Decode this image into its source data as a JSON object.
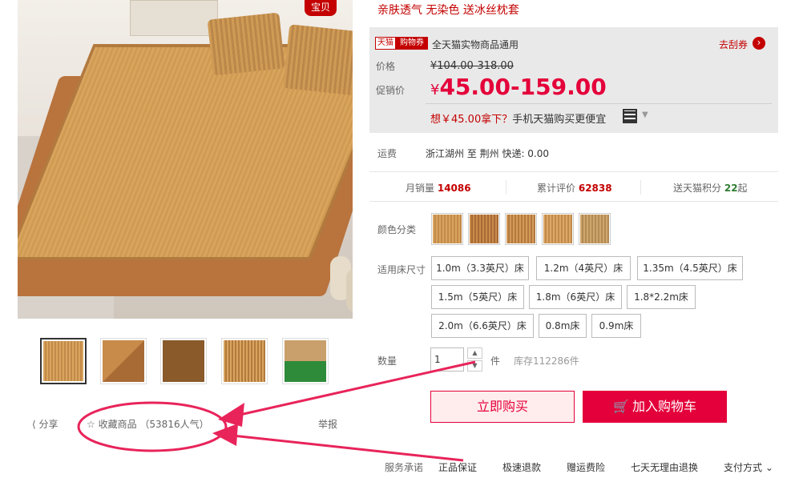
{
  "badge": "宝贝",
  "promo_line": "亲肤透气 无染色 送冰丝枕套",
  "coupon": {
    "tag_tmall": "天猫",
    "tag_coupon": "购物券",
    "text": "全天猫实物商品通用",
    "action": "去刮券"
  },
  "price": {
    "label": "价格",
    "original": "¥104.00-318.00",
    "promo_label": "促销价",
    "currency": "¥",
    "promo_value": "45.00-159.00",
    "mobile_prefix": "想￥45.00拿下？",
    "mobile_text": "手机天猫购买更便宜"
  },
  "shipping": {
    "label": "运费",
    "value": "浙江湖州 至 荆州 快递: 0.00"
  },
  "stats": {
    "monthly_label": "月销量",
    "monthly_value": "14086",
    "reviews_label": "累计评价",
    "reviews_value": "62838",
    "points_label": "送天猫积分",
    "points_value": "22",
    "points_unit": "起"
  },
  "color_label": "颜色分类",
  "size_label": "适用床尺寸",
  "sizes": [
    "1.0m（3.3英尺）床",
    "1.2m（4英尺）床",
    "1.35m（4.5英尺）床",
    "1.5m（5英尺）床",
    "1.8m（6英尺）床",
    "1.8*2.2m床",
    "2.0m（6.6英尺）床",
    "0.8m床",
    "0.9m床"
  ],
  "quantity": {
    "label": "数量",
    "value": "1",
    "unit": "件",
    "stock": "库存112286件"
  },
  "buttons": {
    "buy_now": "立即购买",
    "add_cart": "加入购物车"
  },
  "actions": {
    "share": "分享",
    "favorite": "收藏商品 （53816人气）",
    "report": "举报"
  },
  "services": {
    "label": "服务承诺",
    "items": [
      "正品保证",
      "极速退款",
      "赠运费险",
      "七天无理由退换"
    ],
    "payment": "支付方式"
  },
  "colors": {
    "accent": "#e4003a",
    "tmall_red": "#c40000",
    "annotation": "#e8245a"
  }
}
